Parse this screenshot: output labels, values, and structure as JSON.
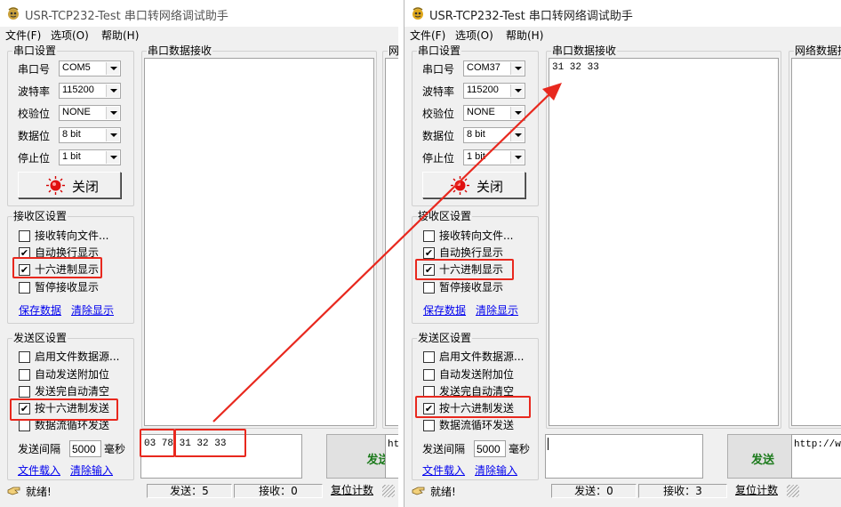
{
  "windows": [
    {
      "title": "USR-TCP232-Test 串口转网络调试助手",
      "menu": [
        "文件(F)",
        "选项(O)",
        "帮助(H)"
      ],
      "serial_settings": {
        "title": "串口设置",
        "fields": [
          {
            "label": "串口号",
            "value": "COM5"
          },
          {
            "label": "波特率",
            "value": "115200"
          },
          {
            "label": "校验位",
            "value": "NONE"
          },
          {
            "label": "数据位",
            "value": "8 bit"
          },
          {
            "label": "停止位",
            "value": "1 bit"
          }
        ],
        "close_button": "关闭"
      },
      "recv_settings": {
        "title": "接收区设置",
        "options": [
          {
            "label": "接收转向文件...",
            "checked": false
          },
          {
            "label": "自动换行显示",
            "checked": true
          },
          {
            "label": "十六进制显示",
            "checked": true
          },
          {
            "label": "暂停接收显示",
            "checked": false
          }
        ],
        "link_save": "保存数据",
        "link_clear": "清除显示"
      },
      "send_settings": {
        "title": "发送区设置",
        "options": [
          {
            "label": "启用文件数据源...",
            "checked": false
          },
          {
            "label": "自动发送附加位",
            "checked": false
          },
          {
            "label": "发送完自动清空",
            "checked": false
          },
          {
            "label": "按十六进制发送",
            "checked": true
          },
          {
            "label": "数据流循环发送",
            "checked": false
          }
        ],
        "interval_label": "发送间隔",
        "interval_value": "5000",
        "interval_unit": "毫秒",
        "link_load": "文件载入",
        "link_clear": "清除输入"
      },
      "recv_panel_title": "串口数据接收",
      "recv_content": "",
      "net_panel_title": "网",
      "net_send_partial": "htt",
      "send_content": "03 78 31 32 33",
      "send_button": "发送",
      "status": {
        "ready": "就绪!",
        "sent": "发送：5",
        "received": "接收：0",
        "reset": "复位计数"
      }
    },
    {
      "title": "USR-TCP232-Test 串口转网络调试助手",
      "menu": [
        "文件(F)",
        "选项(O)",
        "帮助(H)"
      ],
      "serial_settings": {
        "title": "串口设置",
        "fields": [
          {
            "label": "串口号",
            "value": "COM37"
          },
          {
            "label": "波特率",
            "value": "115200"
          },
          {
            "label": "校验位",
            "value": "NONE"
          },
          {
            "label": "数据位",
            "value": "8 bit"
          },
          {
            "label": "停止位",
            "value": "1 bit"
          }
        ],
        "close_button": "关闭"
      },
      "recv_settings": {
        "title": "接收区设置",
        "options": [
          {
            "label": "接收转向文件...",
            "checked": false
          },
          {
            "label": "自动换行显示",
            "checked": true
          },
          {
            "label": "十六进制显示",
            "checked": true
          },
          {
            "label": "暂停接收显示",
            "checked": false
          }
        ],
        "link_save": "保存数据",
        "link_clear": "清除显示"
      },
      "send_settings": {
        "title": "发送区设置",
        "options": [
          {
            "label": "启用文件数据源...",
            "checked": false
          },
          {
            "label": "自动发送附加位",
            "checked": false
          },
          {
            "label": "发送完自动清空",
            "checked": false
          },
          {
            "label": "按十六进制发送",
            "checked": true
          },
          {
            "label": "数据流循环发送",
            "checked": false
          }
        ],
        "interval_label": "发送间隔",
        "interval_value": "5000",
        "interval_unit": "毫秒",
        "link_load": "文件载入",
        "link_clear": "清除输入"
      },
      "recv_panel_title": "串口数据接收",
      "recv_content": "31 32 33",
      "net_panel_title": "网络数据接收",
      "net_send_partial": "http://www",
      "send_content": "",
      "send_button": "发送",
      "status": {
        "ready": "就绪!",
        "sent": "发送：0",
        "received": "接收：3",
        "reset": "复位计数"
      }
    }
  ],
  "colors": {
    "highlight": "#e8281e",
    "send_text": "#1b7a1b",
    "link": "#0000ee",
    "window_bg": "#f0f0f0"
  }
}
